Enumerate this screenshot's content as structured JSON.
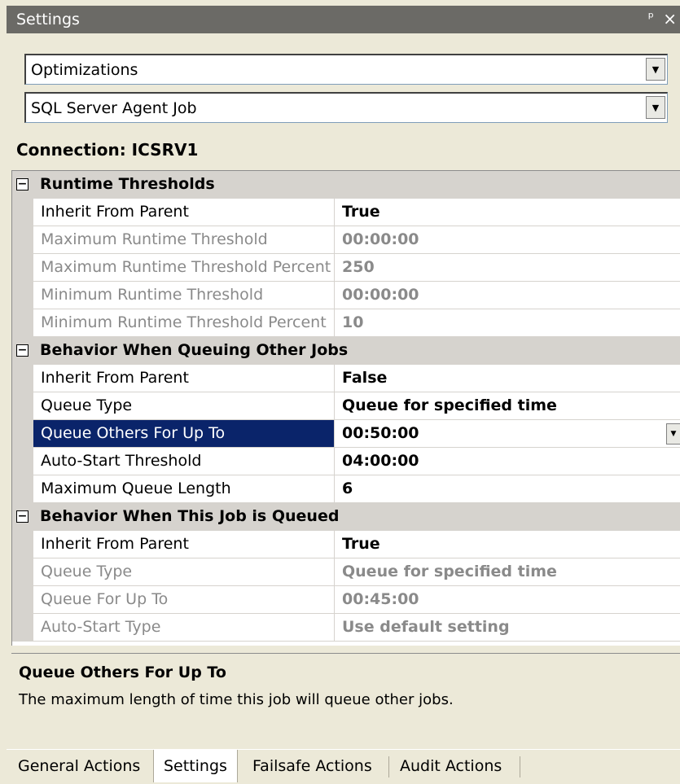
{
  "window": {
    "title": "Settings",
    "pin_glyph": "ᵖ",
    "close_glyph": "×"
  },
  "combos": {
    "category": "Optimizations",
    "object": "SQL Server Agent Job"
  },
  "connection": "Connection: ICSRV1",
  "grid": {
    "categories": [
      {
        "label": "Runtime Thresholds",
        "rows": [
          {
            "name": "Inherit From Parent",
            "value": "True",
            "disabled": false
          },
          {
            "name": "Maximum Runtime Threshold",
            "value": "00:00:00",
            "disabled": true
          },
          {
            "name": "Maximum Runtime Threshold Percent",
            "value": "250",
            "disabled": true
          },
          {
            "name": "Minimum Runtime Threshold",
            "value": "00:00:00",
            "disabled": true
          },
          {
            "name": "Minimum Runtime Threshold Percent",
            "value": "10",
            "disabled": true
          }
        ]
      },
      {
        "label": "Behavior When Queuing Other Jobs",
        "rows": [
          {
            "name": "Inherit From Parent",
            "value": "False",
            "disabled": false
          },
          {
            "name": "Queue Type",
            "value": "Queue for specified time",
            "disabled": false
          },
          {
            "name": "Queue Others For Up To",
            "value": "00:50:00",
            "disabled": false,
            "selected": true
          },
          {
            "name": "Auto-Start Threshold",
            "value": "04:00:00",
            "disabled": false
          },
          {
            "name": "Maximum Queue Length",
            "value": "6",
            "disabled": false
          }
        ]
      },
      {
        "label": "Behavior When This Job is Queued",
        "rows": [
          {
            "name": "Inherit From Parent",
            "value": "True",
            "disabled": false
          },
          {
            "name": "Queue Type",
            "value": "Queue for specified time",
            "disabled": true
          },
          {
            "name": "Queue For Up To",
            "value": "00:45:00",
            "disabled": true
          },
          {
            "name": "Auto-Start Type",
            "value": "Use default setting",
            "disabled": true
          }
        ]
      }
    ]
  },
  "description": {
    "title": "Queue Others For Up To",
    "text": "The maximum length of time this job will queue other jobs."
  },
  "tabs": [
    "General Actions",
    "Settings",
    "Failsafe Actions",
    "Audit Actions"
  ],
  "active_tab": "Settings",
  "colors": {
    "selection": "#0a246a",
    "titlebar": "#6b6a66",
    "panel": "#ece9d8"
  }
}
